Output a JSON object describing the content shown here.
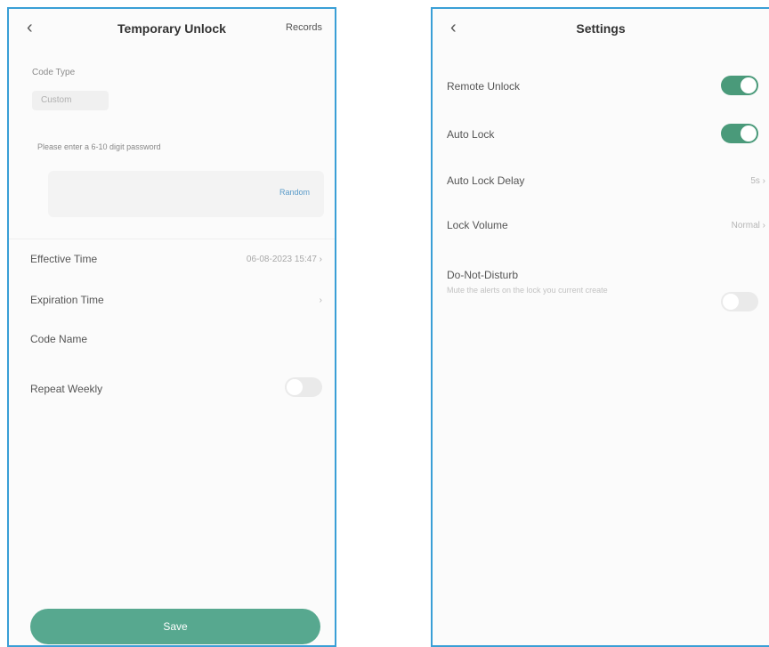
{
  "left": {
    "title": "Temporary Unlock",
    "records": "Records",
    "code_type_label": "Code Type",
    "code_type_value": "Custom",
    "password_hint": "Please enter a 6-10 digit password",
    "password_value": "",
    "random_label": "Random",
    "effective_time_label": "Effective Time",
    "effective_time_value": "06-08-2023 15:47",
    "expiration_time_label": "Expiration Time",
    "expiration_time_value": "",
    "code_name_label": "Code Name",
    "code_name_value": "",
    "repeat_weekly_label": "Repeat Weekly",
    "repeat_weekly_on": false,
    "save_label": "Save"
  },
  "right": {
    "title": "Settings",
    "remote_unlock_label": "Remote Unlock",
    "remote_unlock_on": true,
    "auto_lock_label": "Auto Lock",
    "auto_lock_on": true,
    "auto_lock_delay_label": "Auto Lock Delay",
    "auto_lock_delay_value": "5s",
    "lock_volume_label": "Lock Volume",
    "lock_volume_value": "Normal",
    "dnd_label": "Do-Not-Disturb",
    "dnd_desc": "Mute the alerts on the lock you current create",
    "dnd_on": false
  },
  "colors": {
    "accent": "#4a9a7a",
    "border": "#3a9fd6"
  }
}
